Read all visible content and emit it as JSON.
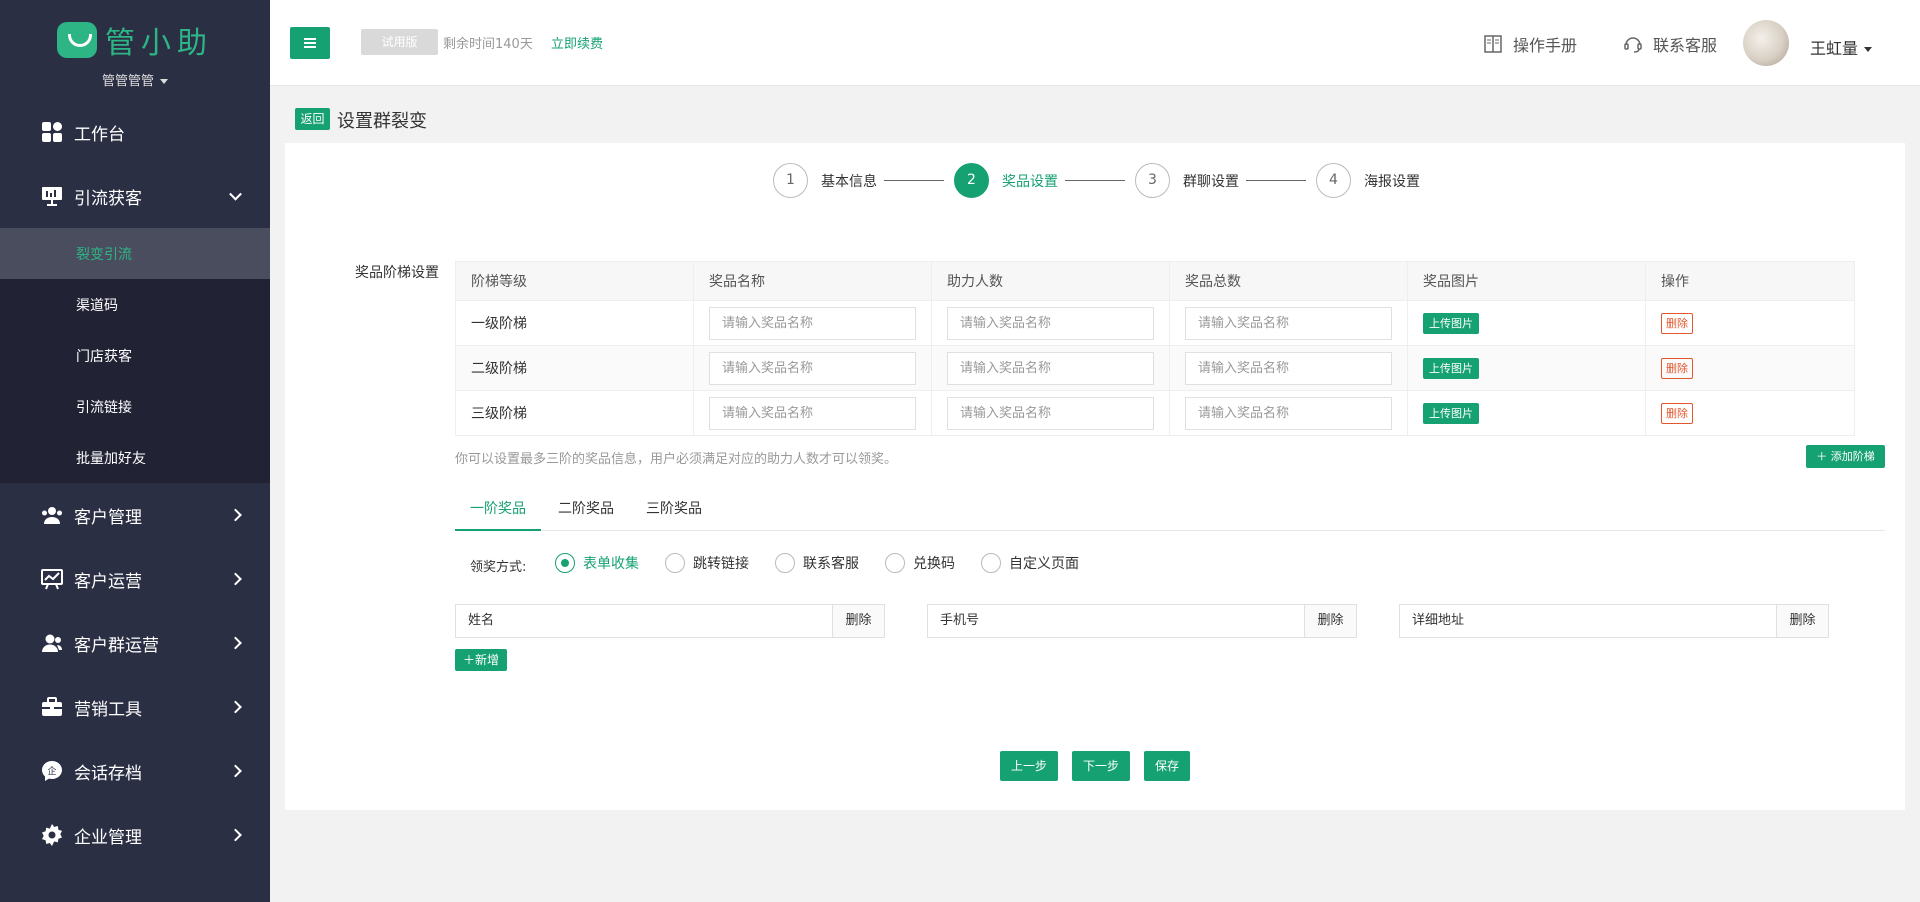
{
  "brand": {
    "logo_text": "管小助",
    "org_name": "管管管管"
  },
  "nav": {
    "items": [
      {
        "label": "工作台",
        "icon": "dashboard-icon"
      },
      {
        "label": "引流获客",
        "icon": "monitor-icon"
      },
      {
        "label": "客户管理",
        "icon": "users-icon"
      },
      {
        "label": "客户运营",
        "icon": "chart-board-icon"
      },
      {
        "label": "客户群运营",
        "icon": "group-icon"
      },
      {
        "label": "营销工具",
        "icon": "briefcase-icon"
      },
      {
        "label": "会话存档",
        "icon": "chat-archive-icon"
      },
      {
        "label": "企业管理",
        "icon": "gear-icon"
      }
    ],
    "sub_items": [
      "裂变引流",
      "渠道码",
      "门店获客",
      "引流链接",
      "批量加好友"
    ]
  },
  "header": {
    "trial_badge": "试用版",
    "remaining": "剩余时间140天",
    "renew": "立即续费",
    "manual": "操作手册",
    "support": "联系客服",
    "user_name": "王虹量"
  },
  "page": {
    "back": "返回",
    "title": "设置群裂变"
  },
  "steps": [
    {
      "num": "1",
      "label": "基本信息"
    },
    {
      "num": "2",
      "label": "奖品设置"
    },
    {
      "num": "3",
      "label": "群聊设置"
    },
    {
      "num": "4",
      "label": "海报设置"
    }
  ],
  "prize_section": {
    "label": "奖品阶梯设置",
    "columns": [
      "阶梯等级",
      "奖品名称",
      "助力人数",
      "奖品总数",
      "奖品图片",
      "操作"
    ],
    "rows": [
      {
        "level": "一级阶梯"
      },
      {
        "level": "二级阶梯"
      },
      {
        "level": "三级阶梯"
      }
    ],
    "input_placeholder": "请输入奖品名称",
    "upload_label": "上传图片",
    "delete_label": "删除",
    "hint": "你可以设置最多三阶的奖品信息，用户必须满足对应的助力人数才可以领奖。",
    "add_tier": "＋ 添加阶梯"
  },
  "tabs": [
    "一阶奖品",
    "二阶奖品",
    "三阶奖品"
  ],
  "claim": {
    "label": "领奖方式:",
    "options": [
      "表单收集",
      "跳转链接",
      "联系客服",
      "兑换码",
      "自定义页面"
    ],
    "selected": "表单收集"
  },
  "fields": {
    "items": [
      "姓名",
      "手机号",
      "详细地址"
    ],
    "delete_label": "删除",
    "add_label": "＋新增"
  },
  "footer": {
    "prev": "上一步",
    "next": "下一步",
    "save": "保存"
  },
  "colors": {
    "accent": "#16a173",
    "sidebar": "#2b2f44",
    "danger": "#e4572e"
  }
}
